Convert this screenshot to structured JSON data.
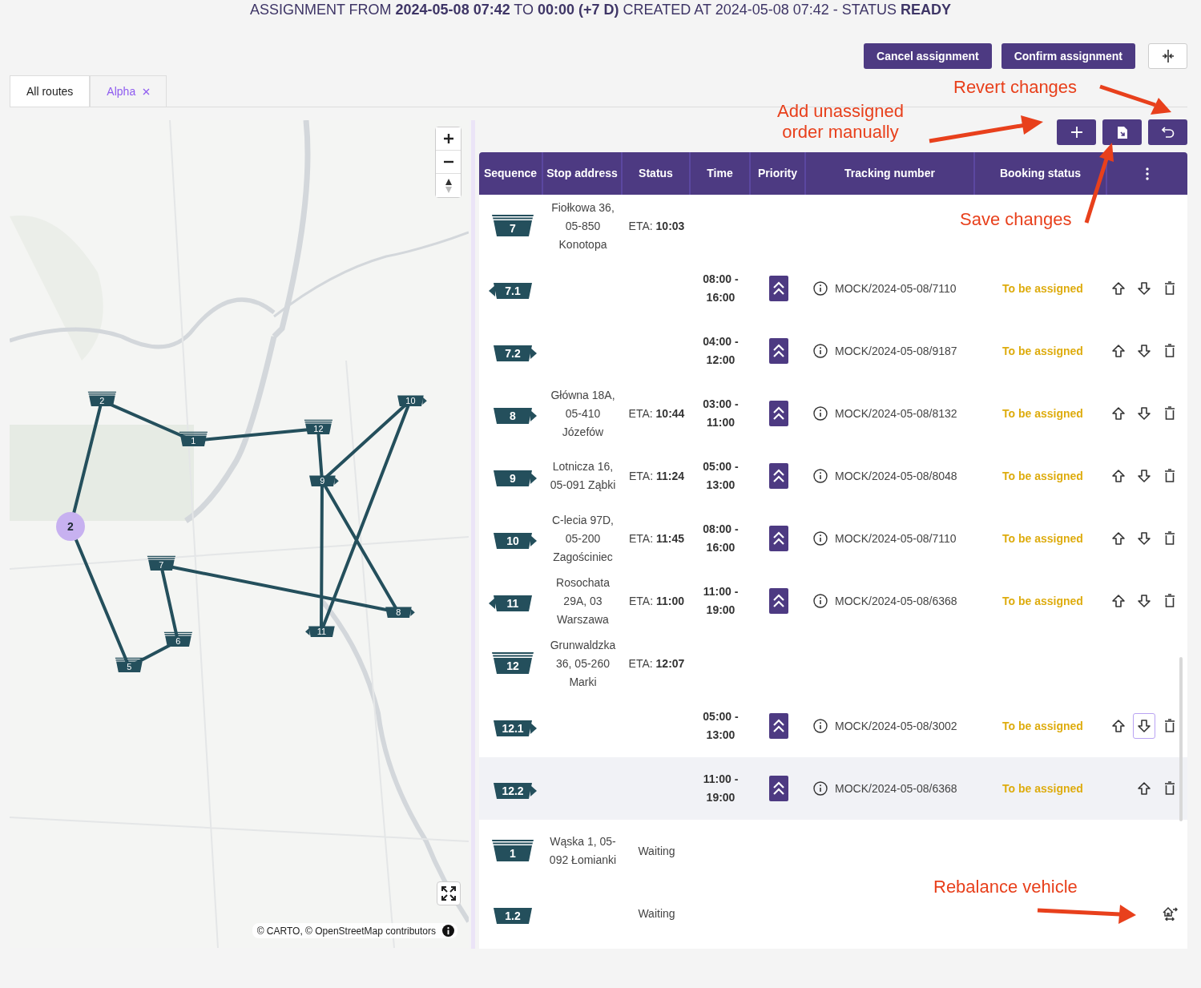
{
  "header": {
    "title": "ASSIGNMENT FROM **2024-05-08 07:42** TO **00:00 (+7 D)** CREATED AT 2024-05-08 07:42 - STATUS **READY**"
  },
  "actions": [
    {
      "label": "Cancel assignment"
    },
    {
      "label": "Confirm assignment"
    }
  ],
  "tabs": [
    {
      "label": "All routes",
      "selected": false,
      "closable": false
    },
    {
      "label": "Alpha",
      "selected": true,
      "closable": true
    }
  ],
  "map": {
    "attribution": "© CARTO, © OpenStreetMap contributors",
    "markers": [
      {
        "label": "2",
        "kind": "stack"
      },
      {
        "label": "1",
        "kind": "stack"
      },
      {
        "label": "12",
        "kind": "stack"
      },
      {
        "label": "10",
        "kind": "right"
      },
      {
        "label": "9",
        "kind": "right"
      },
      {
        "label": "2",
        "kind": "circle"
      },
      {
        "label": "7",
        "kind": "stack"
      },
      {
        "label": "6",
        "kind": "stack"
      },
      {
        "label": "5",
        "kind": "stack"
      },
      {
        "label": "8",
        "kind": "right"
      },
      {
        "label": "11",
        "kind": "left"
      }
    ]
  },
  "table": {
    "columns": [
      "Sequence",
      "Stop address",
      "Status",
      "Time",
      "Priority",
      "Tracking number",
      "Booking status"
    ],
    "rows": [
      {
        "sequence": "7",
        "marker": {
          "kind": "stack"
        },
        "address": "Fiołkowa 36, 05-850 Konotopa",
        "status": "ETA: **10:03**",
        "highlighted": false
      },
      {
        "sequence": "7.1",
        "marker": {
          "kind": "left"
        },
        "time": "08:00 - 16:00",
        "high_priority": true,
        "tracking": "MOCK/2024-05-08/7110",
        "booking": "To be assigned",
        "highlighted": false,
        "row_actions": [
          {
            "kind": "up",
            "focused": false
          },
          {
            "kind": "down",
            "focused": false
          },
          {
            "kind": "delete",
            "focused": false
          }
        ]
      },
      {
        "sequence": "7.2",
        "marker": {
          "kind": "right"
        },
        "time": "04:00 - 12:00",
        "high_priority": true,
        "tracking": "MOCK/2024-05-08/9187",
        "booking": "To be assigned",
        "highlighted": false,
        "row_actions": [
          {
            "kind": "up",
            "focused": false
          },
          {
            "kind": "down",
            "focused": false
          },
          {
            "kind": "delete",
            "focused": false
          }
        ]
      },
      {
        "sequence": "8",
        "marker": {
          "kind": "right"
        },
        "address": "Główna 18A, 05-410 Józefów",
        "status": "ETA: **10:44**",
        "time": "03:00 - 11:00",
        "high_priority": true,
        "tracking": "MOCK/2024-05-08/8132",
        "booking": "To be assigned",
        "highlighted": false,
        "row_actions": [
          {
            "kind": "up",
            "focused": false
          },
          {
            "kind": "down",
            "focused": false
          },
          {
            "kind": "delete",
            "focused": false
          }
        ]
      },
      {
        "sequence": "9",
        "marker": {
          "kind": "right"
        },
        "address": "Lotnicza 16, 05-091 Ząbki",
        "status": "ETA: **11:24**",
        "time": "05:00 - 13:00",
        "high_priority": true,
        "tracking": "MOCK/2024-05-08/8048",
        "booking": "To be assigned",
        "highlighted": false,
        "row_actions": [
          {
            "kind": "up",
            "focused": false
          },
          {
            "kind": "down",
            "focused": false
          },
          {
            "kind": "delete",
            "focused": false
          }
        ]
      },
      {
        "sequence": "10",
        "marker": {
          "kind": "right"
        },
        "address": "C-lecia 97D, 05-200 Zagościniec",
        "status": "ETA: **11:45**",
        "time": "08:00 - 16:00",
        "high_priority": true,
        "tracking": "MOCK/2024-05-08/7110",
        "booking": "To be assigned",
        "highlighted": false,
        "row_actions": [
          {
            "kind": "up",
            "focused": false
          },
          {
            "kind": "down",
            "focused": false
          },
          {
            "kind": "delete",
            "focused": false
          }
        ]
      },
      {
        "sequence": "11",
        "marker": {
          "kind": "left"
        },
        "address": "Rosochata 29A, 03 Warszawa",
        "status": "ETA: **11:00**",
        "time": "11:00 - 19:00",
        "high_priority": true,
        "tracking": "MOCK/2024-05-08/6368",
        "booking": "To be assigned",
        "highlighted": false,
        "row_actions": [
          {
            "kind": "up",
            "focused": false
          },
          {
            "kind": "down",
            "focused": false
          },
          {
            "kind": "delete",
            "focused": false
          }
        ]
      },
      {
        "sequence": "12",
        "marker": {
          "kind": "stack"
        },
        "address": "Grunwaldzka 36, 05-260 Marki",
        "status": "ETA: **12:07**",
        "highlighted": false
      },
      {
        "sequence": "12.1",
        "marker": {
          "kind": "right"
        },
        "time": "05:00 - 13:00",
        "high_priority": true,
        "tracking": "MOCK/2024-05-08/3002",
        "booking": "To be assigned",
        "highlighted": false,
        "row_actions": [
          {
            "kind": "up",
            "focused": false
          },
          {
            "kind": "down",
            "focused": true
          },
          {
            "kind": "delete",
            "focused": false
          }
        ]
      },
      {
        "sequence": "12.2",
        "marker": {
          "kind": "right"
        },
        "time": "11:00 - 19:00",
        "high_priority": true,
        "tracking": "MOCK/2024-05-08/6368",
        "booking": "To be assigned",
        "highlighted": true,
        "row_actions": [
          {
            "kind": "up",
            "focused": false
          },
          {
            "kind": "delete",
            "focused": false
          }
        ]
      },
      {
        "sequence": "1",
        "marker": {
          "kind": "stack"
        },
        "address": "Wąska 1, 05-092 Łomianki",
        "status": "Waiting",
        "highlighted": false
      },
      {
        "sequence": "1.2",
        "marker": {
          "kind": "plain"
        },
        "status": "Waiting",
        "highlighted": false,
        "row_actions": [
          {
            "kind": "rebalance",
            "focused": false
          }
        ]
      }
    ]
  },
  "annotations": [
    {
      "text": "Revert changes"
    },
    {
      "text": "Add unassigned order manually"
    },
    {
      "text": "Save changes"
    },
    {
      "text": "Rebalance vehicle"
    }
  ]
}
